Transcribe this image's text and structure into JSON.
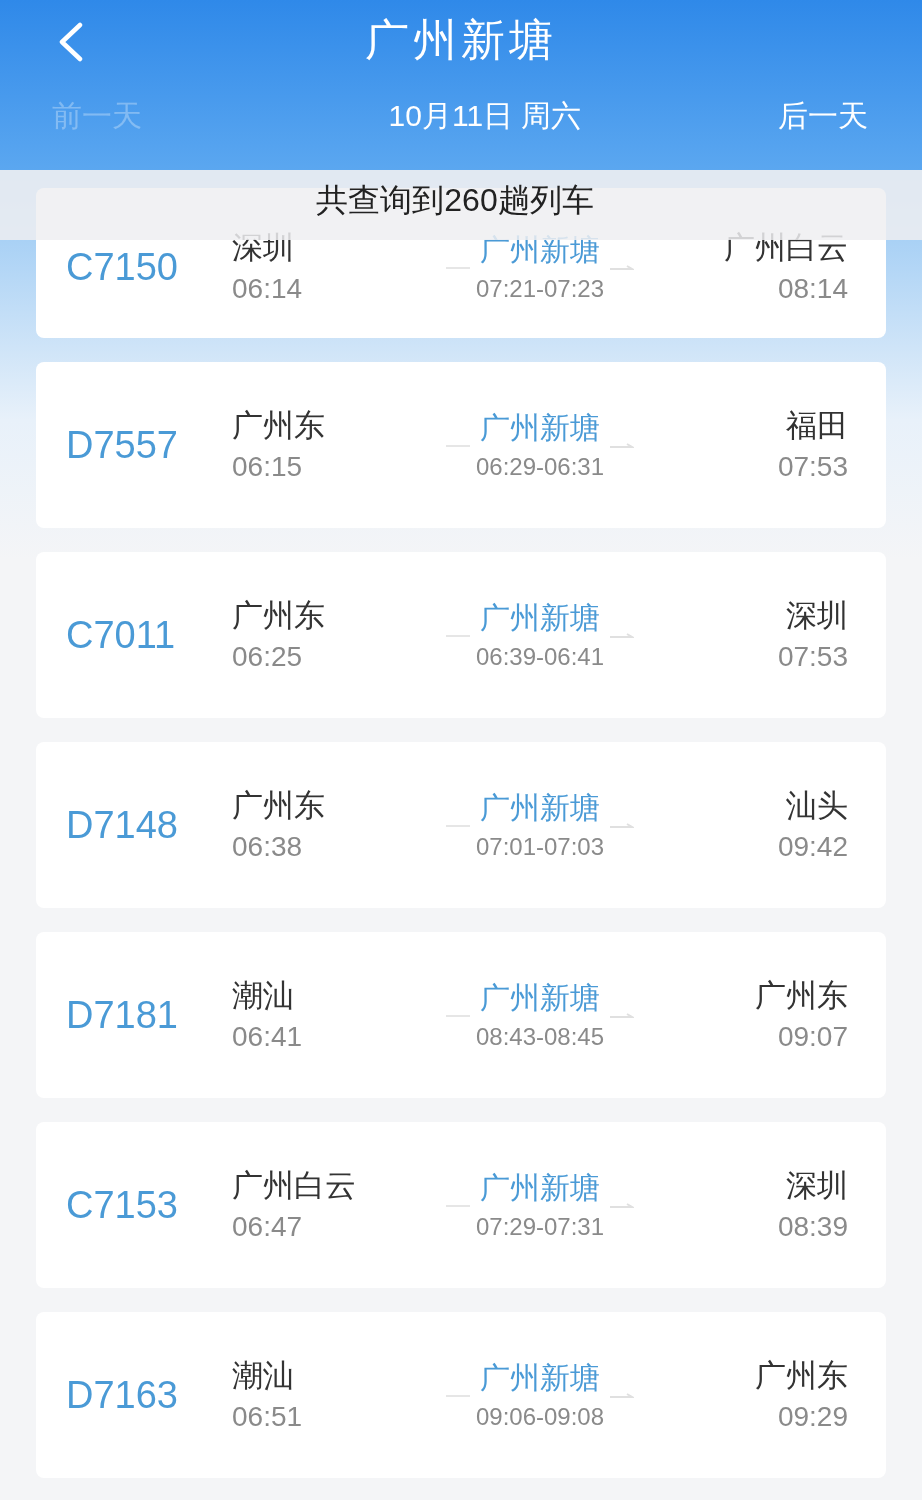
{
  "header": {
    "title": "广州新塘",
    "date": "10月11日 周六",
    "prev_day": {
      "label": "前一天",
      "disabled": true
    },
    "next_day": {
      "label": "后一天",
      "disabled": false
    }
  },
  "result_banner": "共查询到260趟列车",
  "trains": [
    {
      "number": "C7150",
      "from": "深圳",
      "depart": "06:14",
      "via": "广州新塘",
      "via_time": "07:21-07:23",
      "to": "广州白云",
      "arrive": "08:14"
    },
    {
      "number": "D7557",
      "from": "广州东",
      "depart": "06:15",
      "via": "广州新塘",
      "via_time": "06:29-06:31",
      "to": "福田",
      "arrive": "07:53"
    },
    {
      "number": "C7011",
      "from": "广州东",
      "depart": "06:25",
      "via": "广州新塘",
      "via_time": "06:39-06:41",
      "to": "深圳",
      "arrive": "07:53"
    },
    {
      "number": "D7148",
      "from": "广州东",
      "depart": "06:38",
      "via": "广州新塘",
      "via_time": "07:01-07:03",
      "to": "汕头",
      "arrive": "09:42"
    },
    {
      "number": "D7181",
      "from": "潮汕",
      "depart": "06:41",
      "via": "广州新塘",
      "via_time": "08:43-08:45",
      "to": "广州东",
      "arrive": "09:07"
    },
    {
      "number": "C7153",
      "from": "广州白云",
      "depart": "06:47",
      "via": "广州新塘",
      "via_time": "07:29-07:31",
      "to": "深圳",
      "arrive": "08:39"
    },
    {
      "number": "D7163",
      "from": "潮汕",
      "depart": "06:51",
      "via": "广州新塘",
      "via_time": "09:06-09:08",
      "to": "广州东",
      "arrive": "09:29"
    }
  ]
}
